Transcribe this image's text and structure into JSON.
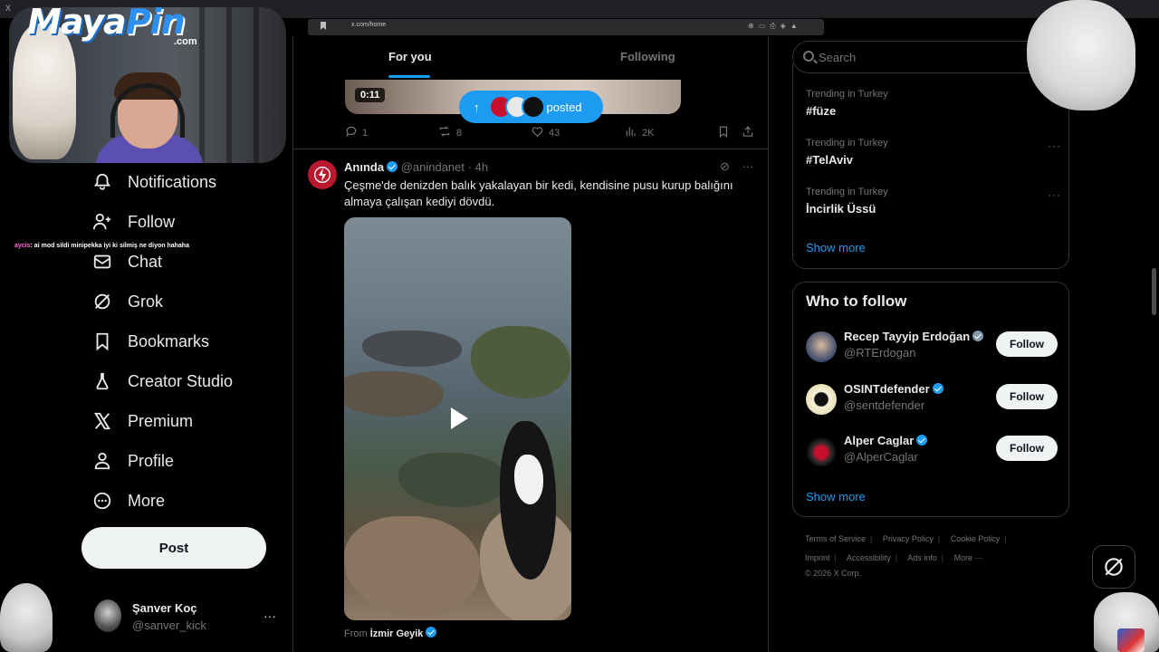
{
  "browser": {
    "url": "x.com/home",
    "tab_glyph": "X"
  },
  "stream": {
    "logo_main": "MayaPin",
    "logo_accent": "Pin",
    "logo_prefix": "Maya",
    "logo_domain": ".com",
    "chat_user": "aycis",
    "chat_message": ": ai mod sildi minipekka iyi ki silmiş ne diyon hahaha"
  },
  "nav": {
    "items": [
      {
        "label": "Notifications",
        "icon": "bell-icon"
      },
      {
        "label": "Follow",
        "icon": "person-plus-icon"
      },
      {
        "label": "Chat",
        "icon": "envelope-icon"
      },
      {
        "label": "Grok",
        "icon": "grok-icon"
      },
      {
        "label": "Bookmarks",
        "icon": "bookmark-icon"
      },
      {
        "label": "Creator Studio",
        "icon": "flask-icon"
      },
      {
        "label": "Premium",
        "icon": "x-logo-icon"
      },
      {
        "label": "Profile",
        "icon": "person-icon"
      },
      {
        "label": "More",
        "icon": "more-circle-icon"
      }
    ],
    "post_label": "Post"
  },
  "account": {
    "name": "Şanver Koç",
    "handle": "@sanver_kick",
    "more": "···"
  },
  "timeline": {
    "tabs": [
      {
        "label": "For you",
        "active": true
      },
      {
        "label": "Following",
        "active": false
      }
    ],
    "prev_post": {
      "duration": "0:11",
      "posted_label": "posted",
      "replies": "1",
      "reposts": "8",
      "likes": "43",
      "views": "2K"
    },
    "tweet": {
      "name": "Anında",
      "handle": "@anindanet",
      "time": "4h",
      "text": "Çeşme'de denizden balık yakalayan bir kedi, kendisine pusu kurup balığını almaya çalışan kediyi dövdü.",
      "from_prefix": "From",
      "from_source": "İzmir Geyik"
    }
  },
  "sidebar": {
    "search_placeholder": "Search",
    "trends": [
      {
        "context": "Trending in Turkey",
        "name": "#füze"
      },
      {
        "context": "Trending in Turkey",
        "name": "#TelAviv"
      },
      {
        "context": "Trending in Turkey",
        "name": "İncirlik Üssü"
      }
    ],
    "show_more": "Show more",
    "who_to_follow_title": "Who to follow",
    "who_to_follow": [
      {
        "name": "Recep Tayyip Erdoğan",
        "handle": "@RTErdogan",
        "badge": "gray",
        "button": "Follow"
      },
      {
        "name": "OSINTdefender",
        "handle": "@sentdefender",
        "badge": "blue",
        "button": "Follow"
      },
      {
        "name": "Alper Caglar",
        "handle": "@AlperCaglar",
        "badge": "blue",
        "button": "Follow"
      }
    ],
    "footer": {
      "line1": [
        "Terms of Service",
        "Privacy Policy",
        "Cookie Policy"
      ],
      "line2": [
        "Imprint",
        "Accessibility",
        "Ads info",
        "More ···"
      ],
      "copyright": "© 2026 X Corp."
    }
  },
  "colors": {
    "accent": "#1d9bf0",
    "background": "#000000",
    "text": "#e7e9ea",
    "muted": "#71767b",
    "border": "#2f3336"
  }
}
